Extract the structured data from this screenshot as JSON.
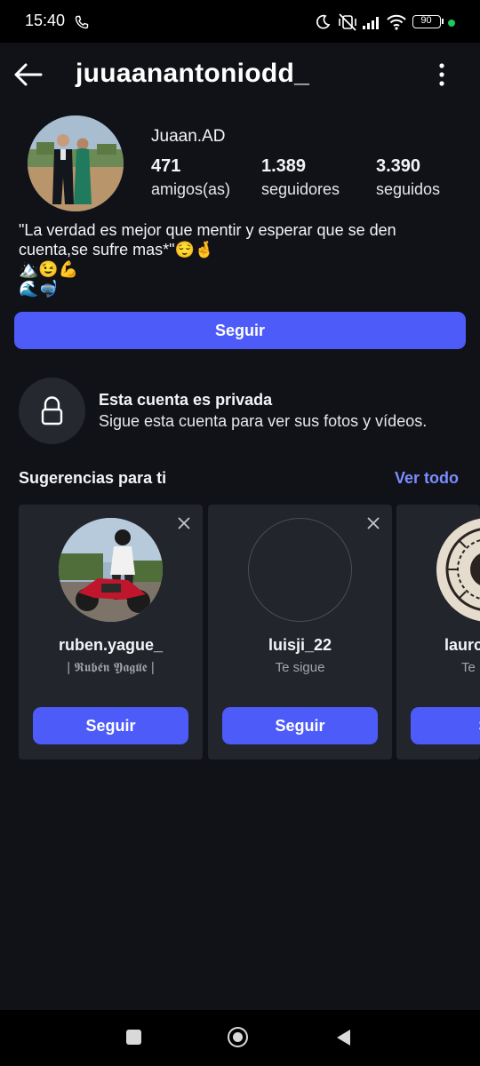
{
  "status_bar": {
    "time": "15:40",
    "battery": "90",
    "icons": [
      "phone-call-icon",
      "moon-icon",
      "vibrate-off-icon",
      "signal-icon",
      "wifi-icon",
      "battery-icon",
      "green-dot-icon"
    ]
  },
  "header": {
    "username": "juuaanantoniodd_",
    "icons": [
      "back-arrow-icon",
      "more-vertical-icon"
    ]
  },
  "profile": {
    "display_name": "Juaan.AD",
    "stats": [
      {
        "value": "471",
        "label": "amigos(as)"
      },
      {
        "value": "1.389",
        "label": "seguidores"
      },
      {
        "value": "3.390",
        "label": "seguidos"
      }
    ],
    "bio_line1": "\"La verdad es mejor que mentir y esperar que se den",
    "bio_line2": "cuenta,se sufre mas*\"😌🤞",
    "bio_line3": "🏔️😉💪",
    "bio_line4": "🌊🤿",
    "follow_label": "Seguir"
  },
  "private_notice": {
    "title": "Esta cuenta es privada",
    "subtitle": "Sigue esta cuenta para ver sus fotos y vídeos.",
    "icon": "lock-icon"
  },
  "suggestions": {
    "title": "Sugerencias para ti",
    "see_all": "Ver todo",
    "cards": [
      {
        "name": "ruben.yague_",
        "subtitle": "| 𝕽𝖚𝖇𝖊́𝖓 𝖄𝖆𝖌𝖚̈𝖊 |",
        "button": "Seguir"
      },
      {
        "name": "luisji_22",
        "subtitle": "Te sigue",
        "button": "Seguir"
      },
      {
        "name": "laurc",
        "subtitle": "Te",
        "button": "Se"
      }
    ]
  },
  "nav_bar": {
    "icons": [
      "recents-square-icon",
      "home-circle-icon",
      "back-triangle-icon"
    ]
  },
  "colors": {
    "background": "#101217",
    "accent": "#4d5bf9",
    "link": "#7c8cff",
    "card": "#22252b"
  }
}
